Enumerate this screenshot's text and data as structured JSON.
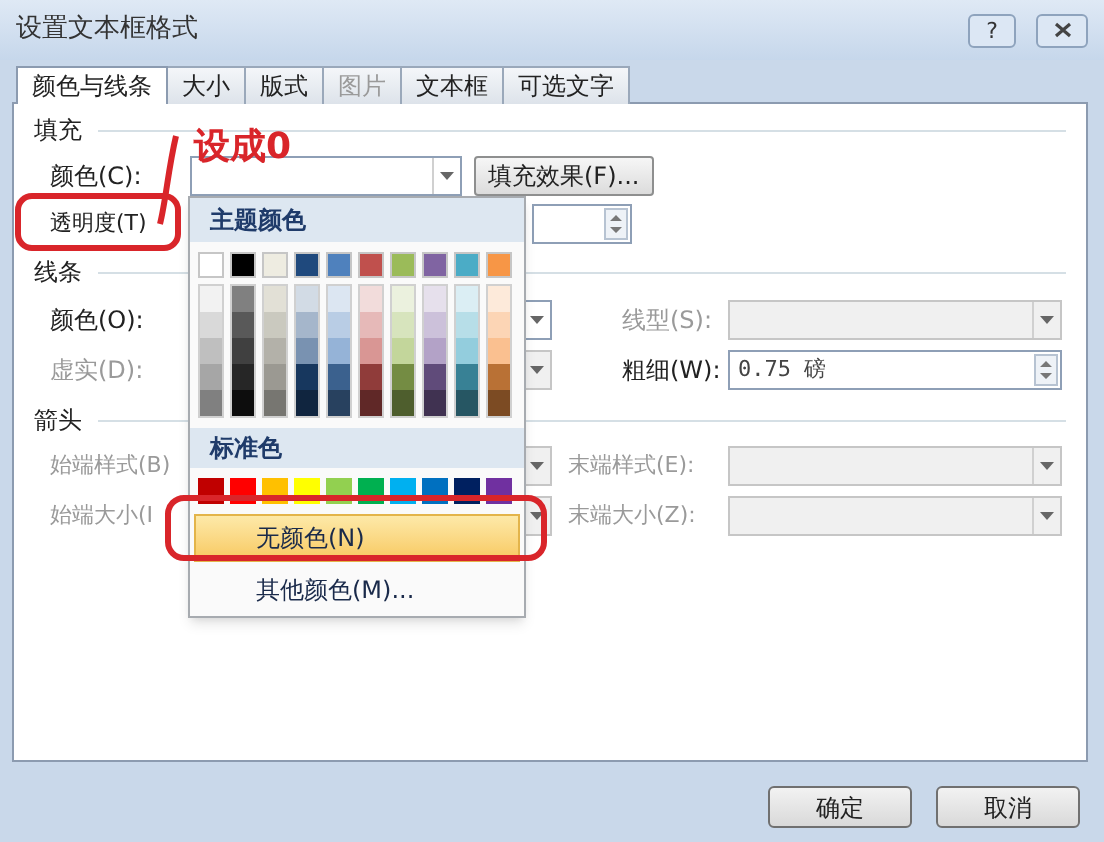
{
  "window": {
    "title": "设置文本框格式",
    "help": "?"
  },
  "tabs": [
    {
      "label": "颜色与线条",
      "selected": true,
      "disabled": false
    },
    {
      "label": "大小",
      "selected": false,
      "disabled": false
    },
    {
      "label": "版式",
      "selected": false,
      "disabled": false
    },
    {
      "label": "图片",
      "selected": false,
      "disabled": true
    },
    {
      "label": "文本框",
      "selected": false,
      "disabled": false
    },
    {
      "label": "可选文字",
      "selected": false,
      "disabled": false
    }
  ],
  "fill": {
    "heading": "填充",
    "color_label": "颜色(C):",
    "fill_effects_button": "填充效果(F)...",
    "transparency_label": "透明度(T)"
  },
  "line": {
    "heading": "线条",
    "color_label": "颜色(O):",
    "dash_label": "虚实(D):",
    "dash_disabled": true,
    "style_label": "线型(S):",
    "style_disabled": true,
    "weight_label": "粗细(W):",
    "weight_value": "0.75 磅"
  },
  "arrows": {
    "heading": "箭头",
    "disabled": true,
    "begin_style_label": "始端样式(B)",
    "begin_size_label": "始端大小(I",
    "end_style_label": "末端样式(E):",
    "end_size_label": "末端大小(Z):"
  },
  "color_menu": {
    "theme_heading": "主题颜色",
    "theme_colors": [
      {
        "color": "#ffffff"
      },
      {
        "color": "#000000"
      },
      {
        "color": "#eeece1"
      },
      {
        "color": "#1f497d"
      },
      {
        "color": "#4f81bd"
      },
      {
        "color": "#c0504d"
      },
      {
        "color": "#9bbb59"
      },
      {
        "color": "#8064a2"
      },
      {
        "color": "#4bacc6"
      },
      {
        "color": "#f79646"
      }
    ],
    "standard_heading": "标准色",
    "standard_colors": [
      {
        "color": "#c00000"
      },
      {
        "color": "#ff0000"
      },
      {
        "color": "#ffc000"
      },
      {
        "color": "#ffff00"
      },
      {
        "color": "#92d050"
      },
      {
        "color": "#00b050"
      },
      {
        "color": "#00b0f0"
      },
      {
        "color": "#0070c0"
      },
      {
        "color": "#002060"
      },
      {
        "color": "#7030a0"
      }
    ],
    "items": [
      {
        "label": "无颜色(N)",
        "selected": true
      },
      {
        "label": "其他颜色(M)...",
        "selected": false
      }
    ]
  },
  "annotation": {
    "text": "设成0"
  },
  "buttons": [
    {
      "label": "确定"
    },
    {
      "label": "取消"
    }
  ]
}
